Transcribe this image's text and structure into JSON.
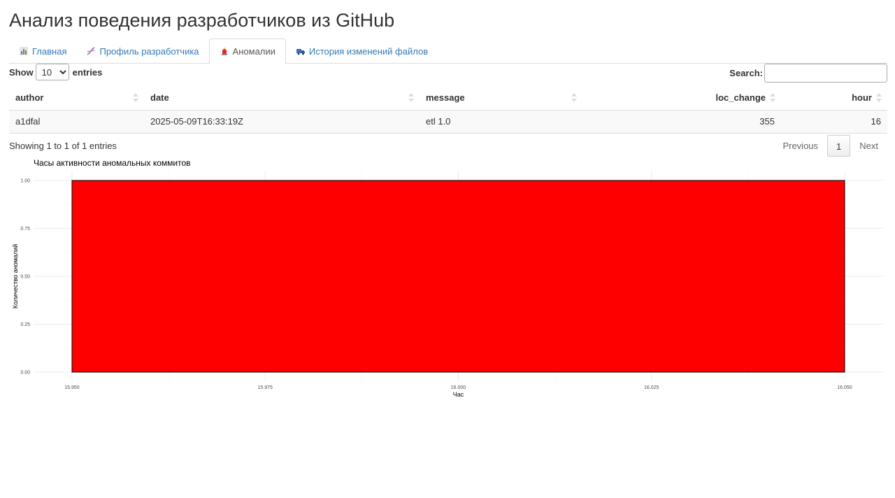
{
  "page_title": "Анализ поведения разработчиков из GitHub",
  "tabs": [
    {
      "label": "Главная",
      "icon": "bar-chart-icon",
      "active": false
    },
    {
      "label": "Профиль разработчика",
      "icon": "dna-icon",
      "active": false
    },
    {
      "label": "Аномалии",
      "icon": "alarm-light-icon",
      "active": true
    },
    {
      "label": "История изменений файлов",
      "icon": "truck-icon",
      "active": false
    }
  ],
  "table_controls": {
    "show_label": "Show",
    "entries_label": "entries",
    "page_length": "10",
    "search_label": "Search:",
    "search_value": ""
  },
  "table": {
    "columns": [
      "author",
      "date",
      "message",
      "loc_change",
      "hour"
    ],
    "rows": [
      [
        "a1dfal",
        "2025-05-09T16:33:19Z",
        "etl 1.0",
        "355",
        "16"
      ]
    ]
  },
  "table_info": "Showing 1 to 1 of 1 entries",
  "pagination": {
    "previous": "Previous",
    "current": "1",
    "next": "Next"
  },
  "chart_data": {
    "type": "bar",
    "title": "Часы активности аномальных коммитов",
    "xlabel": "Час",
    "ylabel": "Количество аномалий",
    "x_ticks": [
      "15.950",
      "15.975",
      "16.000",
      "16.025",
      "16.050"
    ],
    "y_ticks": [
      "0.00",
      "0.25",
      "0.50",
      "0.75",
      "1.00"
    ],
    "xlim": [
      15.95,
      16.05
    ],
    "ylim": [
      0,
      1
    ],
    "bars": [
      {
        "xmin": 15.95,
        "xmax": 16.05,
        "value": 1
      }
    ],
    "bar_color": "#ff0000",
    "grid": true
  }
}
